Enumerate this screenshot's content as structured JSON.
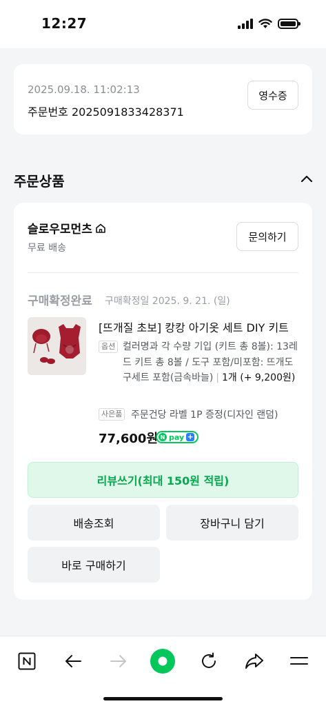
{
  "status_bar": {
    "time": "12:27"
  },
  "order": {
    "datetime": "2025.09.18. 11:02:13",
    "number": "주문번호 2025091833428371",
    "receipt_label": "영수증"
  },
  "section": {
    "title": "주문상품"
  },
  "seller": {
    "name": "슬로우모먼츠",
    "shipping": "무료 배송",
    "inquiry_label": "문의하기"
  },
  "item": {
    "status": "구매확정완료",
    "confirm_date": "구매확정일 2025. 9. 21. (일)",
    "name": "[뜨개질 초보] 캉캉 아기옷 세트 DIY 키트",
    "option_tag": "옵션",
    "option_text": "컬러명과 각 수량 기입 (키트 총 8볼): 13레드 키트 총 8볼 / 도구 포함/미포함: 뜨개도구세트 포함(금속바늘)",
    "quantity_text": "1개 (+ 9,200원)",
    "gift_tag": "사은품",
    "gift_text": "주문건당 라벨 1P 증정(디자인 랜덤)",
    "price": "77,600원",
    "npay_label": "pay"
  },
  "actions": {
    "review": "리뷰쓰기(최대 150원 적립)",
    "track": "배송조회",
    "cart": "장바구니 담기",
    "buy_now": "바로 구매하기"
  },
  "colors": {
    "accent_green": "#03c75a",
    "review_bg": "#e0f8ea",
    "review_text": "#05a94e"
  },
  "bottom_nav": [
    "naver-home-icon",
    "back-arrow-icon",
    "forward-arrow-icon",
    "green-circle-icon",
    "refresh-icon",
    "share-icon",
    "menu-icon"
  ]
}
